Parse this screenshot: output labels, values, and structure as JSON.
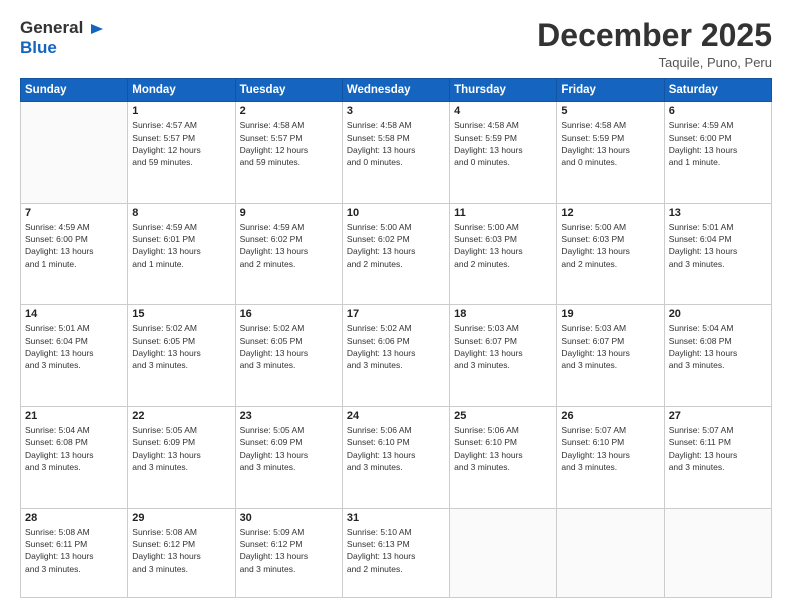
{
  "logo": {
    "line1": "General",
    "line2": "Blue"
  },
  "header": {
    "month": "December 2025",
    "location": "Taquile, Puno, Peru"
  },
  "weekdays": [
    "Sunday",
    "Monday",
    "Tuesday",
    "Wednesday",
    "Thursday",
    "Friday",
    "Saturday"
  ],
  "weeks": [
    [
      {
        "day": "",
        "info": ""
      },
      {
        "day": "1",
        "info": "Sunrise: 4:57 AM\nSunset: 5:57 PM\nDaylight: 12 hours\nand 59 minutes."
      },
      {
        "day": "2",
        "info": "Sunrise: 4:58 AM\nSunset: 5:57 PM\nDaylight: 12 hours\nand 59 minutes."
      },
      {
        "day": "3",
        "info": "Sunrise: 4:58 AM\nSunset: 5:58 PM\nDaylight: 13 hours\nand 0 minutes."
      },
      {
        "day": "4",
        "info": "Sunrise: 4:58 AM\nSunset: 5:59 PM\nDaylight: 13 hours\nand 0 minutes."
      },
      {
        "day": "5",
        "info": "Sunrise: 4:58 AM\nSunset: 5:59 PM\nDaylight: 13 hours\nand 0 minutes."
      },
      {
        "day": "6",
        "info": "Sunrise: 4:59 AM\nSunset: 6:00 PM\nDaylight: 13 hours\nand 1 minute."
      }
    ],
    [
      {
        "day": "7",
        "info": "Sunrise: 4:59 AM\nSunset: 6:00 PM\nDaylight: 13 hours\nand 1 minute."
      },
      {
        "day": "8",
        "info": "Sunrise: 4:59 AM\nSunset: 6:01 PM\nDaylight: 13 hours\nand 1 minute."
      },
      {
        "day": "9",
        "info": "Sunrise: 4:59 AM\nSunset: 6:02 PM\nDaylight: 13 hours\nand 2 minutes."
      },
      {
        "day": "10",
        "info": "Sunrise: 5:00 AM\nSunset: 6:02 PM\nDaylight: 13 hours\nand 2 minutes."
      },
      {
        "day": "11",
        "info": "Sunrise: 5:00 AM\nSunset: 6:03 PM\nDaylight: 13 hours\nand 2 minutes."
      },
      {
        "day": "12",
        "info": "Sunrise: 5:00 AM\nSunset: 6:03 PM\nDaylight: 13 hours\nand 2 minutes."
      },
      {
        "day": "13",
        "info": "Sunrise: 5:01 AM\nSunset: 6:04 PM\nDaylight: 13 hours\nand 3 minutes."
      }
    ],
    [
      {
        "day": "14",
        "info": "Sunrise: 5:01 AM\nSunset: 6:04 PM\nDaylight: 13 hours\nand 3 minutes."
      },
      {
        "day": "15",
        "info": "Sunrise: 5:02 AM\nSunset: 6:05 PM\nDaylight: 13 hours\nand 3 minutes."
      },
      {
        "day": "16",
        "info": "Sunrise: 5:02 AM\nSunset: 6:05 PM\nDaylight: 13 hours\nand 3 minutes."
      },
      {
        "day": "17",
        "info": "Sunrise: 5:02 AM\nSunset: 6:06 PM\nDaylight: 13 hours\nand 3 minutes."
      },
      {
        "day": "18",
        "info": "Sunrise: 5:03 AM\nSunset: 6:07 PM\nDaylight: 13 hours\nand 3 minutes."
      },
      {
        "day": "19",
        "info": "Sunrise: 5:03 AM\nSunset: 6:07 PM\nDaylight: 13 hours\nand 3 minutes."
      },
      {
        "day": "20",
        "info": "Sunrise: 5:04 AM\nSunset: 6:08 PM\nDaylight: 13 hours\nand 3 minutes."
      }
    ],
    [
      {
        "day": "21",
        "info": "Sunrise: 5:04 AM\nSunset: 6:08 PM\nDaylight: 13 hours\nand 3 minutes."
      },
      {
        "day": "22",
        "info": "Sunrise: 5:05 AM\nSunset: 6:09 PM\nDaylight: 13 hours\nand 3 minutes."
      },
      {
        "day": "23",
        "info": "Sunrise: 5:05 AM\nSunset: 6:09 PM\nDaylight: 13 hours\nand 3 minutes."
      },
      {
        "day": "24",
        "info": "Sunrise: 5:06 AM\nSunset: 6:10 PM\nDaylight: 13 hours\nand 3 minutes."
      },
      {
        "day": "25",
        "info": "Sunrise: 5:06 AM\nSunset: 6:10 PM\nDaylight: 13 hours\nand 3 minutes."
      },
      {
        "day": "26",
        "info": "Sunrise: 5:07 AM\nSunset: 6:10 PM\nDaylight: 13 hours\nand 3 minutes."
      },
      {
        "day": "27",
        "info": "Sunrise: 5:07 AM\nSunset: 6:11 PM\nDaylight: 13 hours\nand 3 minutes."
      }
    ],
    [
      {
        "day": "28",
        "info": "Sunrise: 5:08 AM\nSunset: 6:11 PM\nDaylight: 13 hours\nand 3 minutes."
      },
      {
        "day": "29",
        "info": "Sunrise: 5:08 AM\nSunset: 6:12 PM\nDaylight: 13 hours\nand 3 minutes."
      },
      {
        "day": "30",
        "info": "Sunrise: 5:09 AM\nSunset: 6:12 PM\nDaylight: 13 hours\nand 3 minutes."
      },
      {
        "day": "31",
        "info": "Sunrise: 5:10 AM\nSunset: 6:13 PM\nDaylight: 13 hours\nand 2 minutes."
      },
      {
        "day": "",
        "info": ""
      },
      {
        "day": "",
        "info": ""
      },
      {
        "day": "",
        "info": ""
      }
    ]
  ]
}
